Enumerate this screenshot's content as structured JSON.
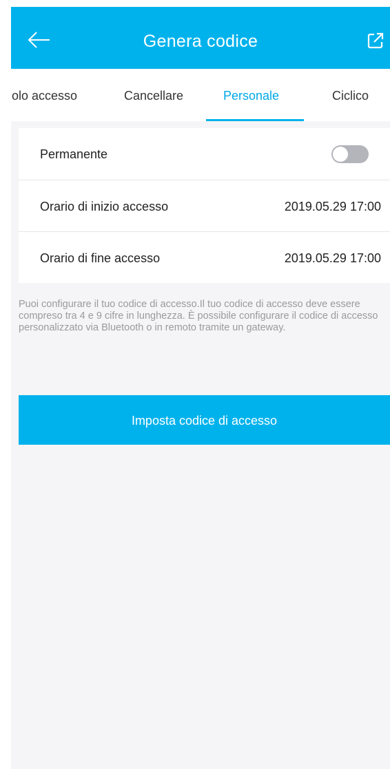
{
  "header": {
    "title": "Genera codice",
    "back_icon": "arrow-left-icon",
    "share_icon": "external-link-icon"
  },
  "tabs": [
    {
      "label": "Singolo accesso",
      "visible_text": "ıgolo accesso",
      "active": false
    },
    {
      "label": "Cancellare",
      "active": false
    },
    {
      "label": "Personale",
      "active": true
    },
    {
      "label": "Ciclico",
      "active": false
    }
  ],
  "settings": {
    "permanent_label": "Permanente",
    "permanent_enabled": false,
    "start_label": "Orario di inizio accesso",
    "start_value": "2019.05.29 17:00",
    "end_label": "Orario di fine accesso",
    "end_value": "2019.05.29 17:00"
  },
  "info_text": "Puoi configurare il tuo codice di accesso.Il tuo codice di accesso deve essere compreso tra 4 e 9 cifre in lunghezza. È possibile configurare il codice di accesso personalizzato via Bluetooth o in remoto tramite un gateway.",
  "primary_button": "Imposta codice di accesso",
  "colors": {
    "accent": "#00b2ec",
    "background": "#f5f5f7",
    "toggle_off": "#b4b4bb",
    "hint_text": "#9a9a9a"
  }
}
